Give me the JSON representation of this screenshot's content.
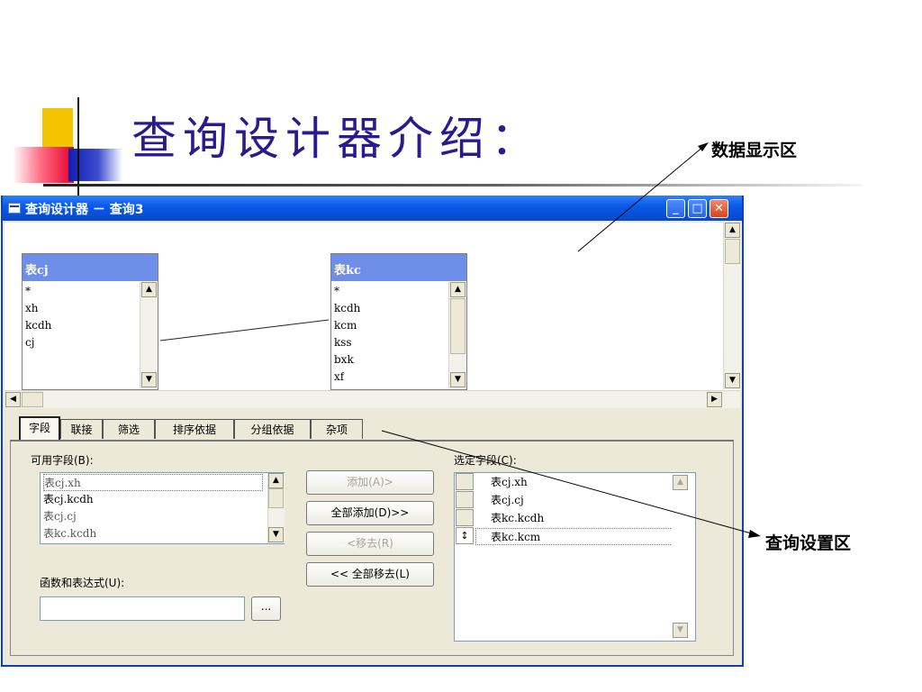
{
  "slide": {
    "title": "查询设计器介绍：",
    "annotation_top": "数据显示区",
    "annotation_right": "查询设置区"
  },
  "window": {
    "title": "查询设计器 － 查询3",
    "buttons": {
      "minimize": "_",
      "maximize": "□",
      "close": "✕"
    }
  },
  "tables": [
    {
      "name": "表cj",
      "fields": [
        "*",
        "xh",
        "kcdh",
        "cj"
      ]
    },
    {
      "name": "表kc",
      "fields": [
        "*",
        "kcdh",
        "kcm",
        "kss",
        "bxk",
        "xf"
      ]
    }
  ],
  "tabs": [
    "字段",
    "联接",
    "筛选",
    "排序依据",
    "分组依据",
    "杂项"
  ],
  "active_tab": "字段",
  "available_fields": {
    "label": "可用字段(B):",
    "items": [
      "表cj.xh",
      "表cj.kcdh",
      "表cj.cj",
      "表kc.kcdh"
    ]
  },
  "buttons": {
    "add": "添加(A)>",
    "add_all": "全部添加(D)>>",
    "remove": "<移去(R)",
    "remove_all": "<< 全部移去(L)"
  },
  "expression": {
    "label": "函数和表达式(U):",
    "value": "",
    "ellipsis": "..."
  },
  "selected_fields": {
    "label": "选定字段(C):",
    "items": [
      "表cj.xh",
      "表cj.cj",
      "表kc.kcdh",
      "表kc.kcm"
    ],
    "move_marker": "↕"
  },
  "icons": [
    "window-icon",
    "minimize-icon",
    "maximize-icon",
    "close-icon",
    "scroll-up-icon",
    "scroll-down-icon",
    "scroll-left-icon",
    "scroll-right-icon"
  ],
  "colors": {
    "title_text": "#2a1a8f",
    "window_border": "#0b3fc4",
    "table_header": "#6f8ee8",
    "dialog_bg": "#ece9d8"
  }
}
